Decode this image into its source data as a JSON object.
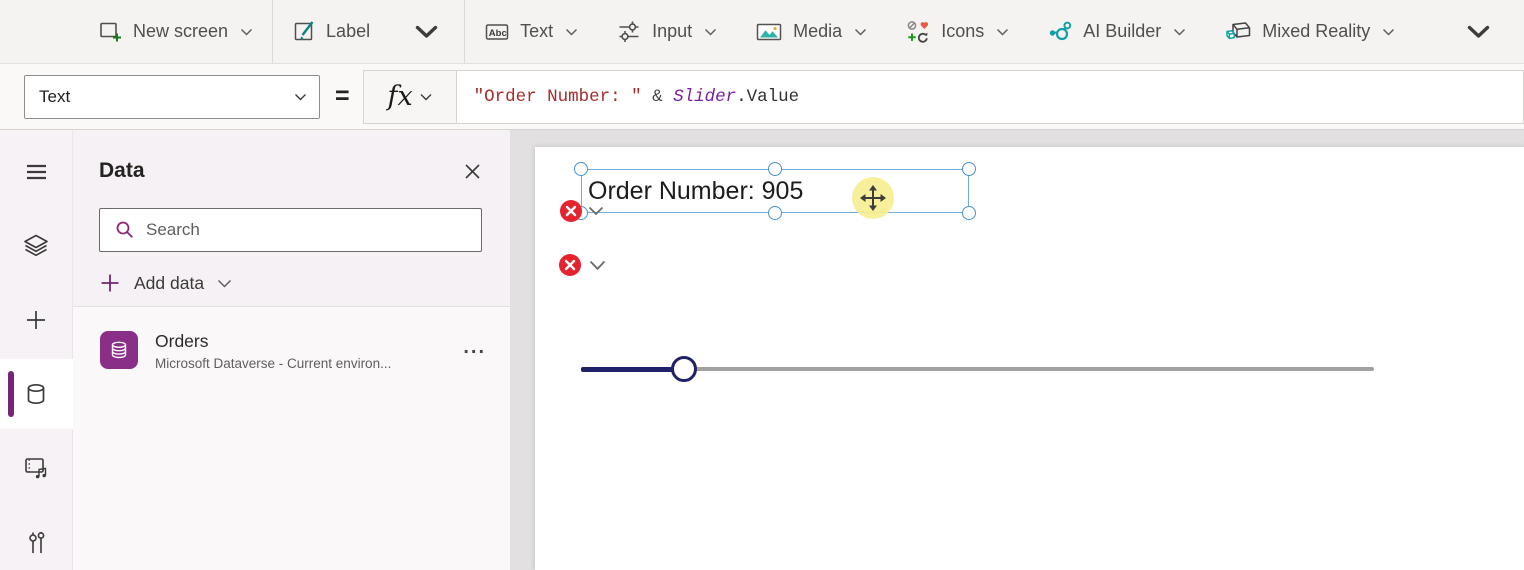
{
  "toolbar": {
    "items": [
      {
        "label": "New screen",
        "icon": "new-screen-icon"
      },
      {
        "label": "Label",
        "icon": "label-icon"
      },
      {
        "label": "Text",
        "icon": "text-icon"
      },
      {
        "label": "Input",
        "icon": "input-icon"
      },
      {
        "label": "Media",
        "icon": "media-icon"
      },
      {
        "label": "Icons",
        "icon": "icons-icon"
      },
      {
        "label": "AI Builder",
        "icon": "ai-builder-icon"
      },
      {
        "label": "Mixed Reality",
        "icon": "mixed-reality-icon"
      }
    ],
    "text_icon_glyph": "Abc"
  },
  "formula_bar": {
    "property": "Text",
    "equals": "=",
    "fx_label": "fx",
    "tokens": {
      "string": "\"Order Number: \"",
      "operator": " & ",
      "entity": "Slider",
      "property": ".Value"
    }
  },
  "data_panel": {
    "title": "Data",
    "search_placeholder": "Search",
    "add_data_label": "Add data",
    "items": [
      {
        "name": "Orders",
        "description": "Microsoft Dataverse - Current environ...",
        "more": "..."
      }
    ]
  },
  "canvas": {
    "label_text": "Order Number: 905",
    "slider": {
      "fill_percent": 13
    },
    "error_badge_count": 2
  },
  "colors": {
    "accent_purple": "#742774",
    "tile_purple": "#8a2f88",
    "selection_blue": "#70b0dd",
    "error_red": "#e5232e",
    "slider_navy": "#20216b",
    "formula_string": "#a62b2b",
    "formula_entity": "#7b1fa2"
  }
}
